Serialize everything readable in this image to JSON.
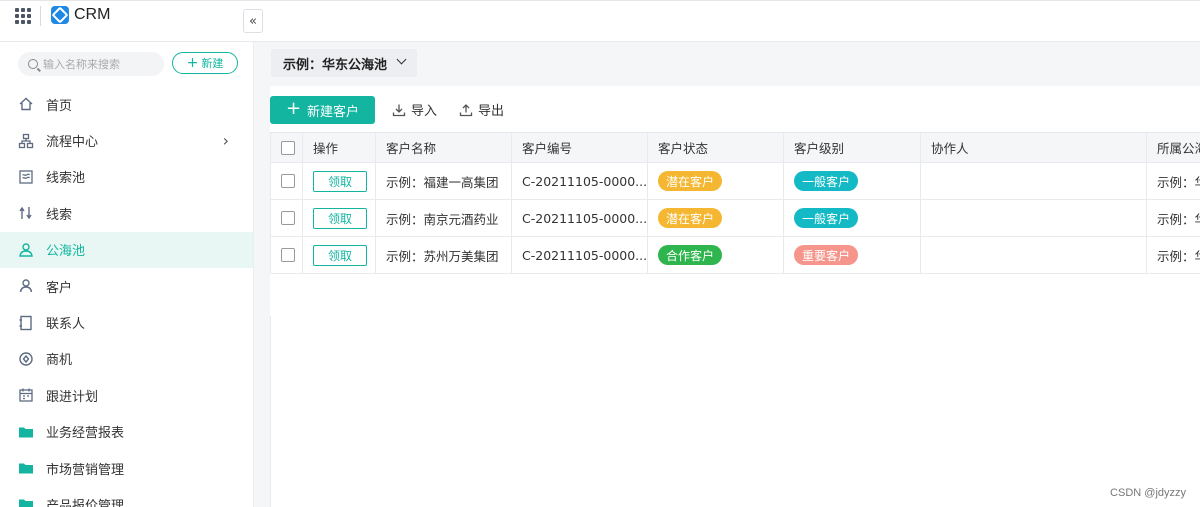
{
  "app": {
    "title": "CRM"
  },
  "sidebar": {
    "search_placeholder": "输入名称来搜索",
    "new_label": "新建",
    "collapse_label": "«",
    "items": [
      {
        "label": "首页",
        "icon": "home-icon",
        "active": false
      },
      {
        "label": "流程中心",
        "icon": "flow-icon",
        "active": false,
        "has_chevron": true
      },
      {
        "label": "线索池",
        "icon": "lead-pool-icon",
        "active": false
      },
      {
        "label": "线索",
        "icon": "lead-icon",
        "active": false
      },
      {
        "label": "公海池",
        "icon": "public-pool-icon",
        "active": true
      },
      {
        "label": "客户",
        "icon": "customer-icon",
        "active": false
      },
      {
        "label": "联系人",
        "icon": "contacts-icon",
        "active": false
      },
      {
        "label": "商机",
        "icon": "opportunity-icon",
        "active": false
      },
      {
        "label": "跟进计划",
        "icon": "calendar-icon",
        "active": false
      },
      {
        "label": "业务经营报表",
        "icon": "folder-icon",
        "active": false
      },
      {
        "label": "市场营销管理",
        "icon": "folder-icon",
        "active": false
      },
      {
        "label": "产品报价管理",
        "icon": "folder-icon",
        "active": false
      }
    ]
  },
  "main": {
    "pool_select": "示例：华东公海池",
    "toolbar": {
      "new_customer": "新建客户",
      "import": "导入",
      "export": "导出"
    },
    "table": {
      "headers": [
        "操作",
        "客户名称",
        "客户编号",
        "客户状态",
        "客户级别",
        "协作人",
        "所属公海"
      ],
      "rows": [
        {
          "action": "领取",
          "name": "示例：福建一高集团",
          "code": "C-20211105-0000...",
          "status": "潜在客户",
          "level": "一般客户",
          "collaborator": "",
          "pool": "示例：华"
        },
        {
          "action": "领取",
          "name": "示例：南京元酒药业",
          "code": "C-20211105-0000...",
          "status": "潜在客户",
          "level": "一般客户",
          "collaborator": "",
          "pool": "示例：华"
        },
        {
          "action": "领取",
          "name": "示例：苏州万美集团",
          "code": "C-20211105-0000...",
          "status": "合作客户",
          "level": "重要客户",
          "collaborator": "",
          "pool": "示例：华"
        }
      ]
    }
  },
  "colors": {
    "accent": "#13b5a1",
    "status_potential": "#f5b731",
    "status_partner": "#2fb54e",
    "level_normal": "#13b9c4",
    "level_important": "#f5958b"
  },
  "watermark": "CSDN @jdyzzy"
}
